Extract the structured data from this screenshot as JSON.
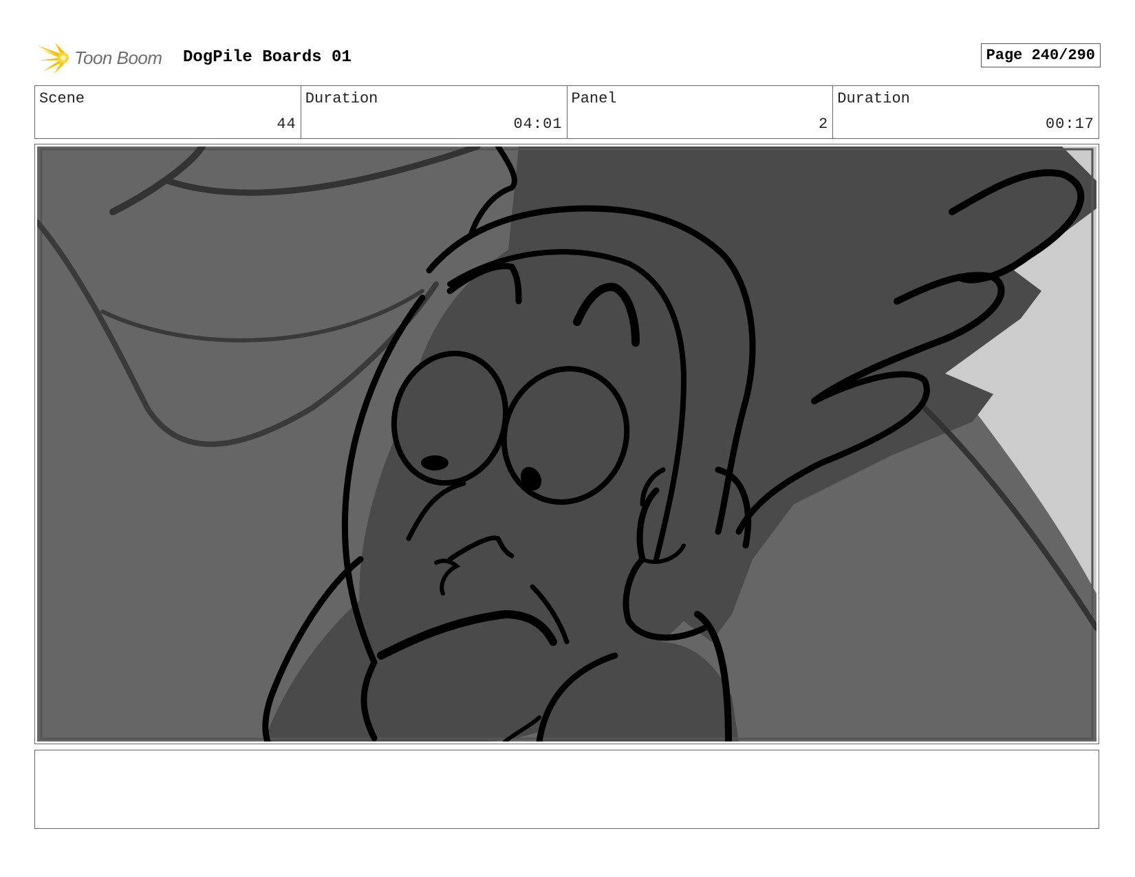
{
  "header": {
    "logo_text": "Toon Boom",
    "project_title": "DogPile Boards 01",
    "page_label": "Page 240/290"
  },
  "info": {
    "scene_label": "Scene",
    "scene_value": "44",
    "scene_duration_label": "Duration",
    "scene_duration_value": "04:01",
    "panel_label": "Panel",
    "panel_value": "2",
    "panel_duration_label": "Duration",
    "panel_duration_value": "00:17"
  },
  "notes": {
    "text": ""
  },
  "colors": {
    "logo_accent": "#f5c400",
    "panel_bg": "#666666",
    "character_fill": "#4a4a4a",
    "light_bg": "#cccccc"
  }
}
